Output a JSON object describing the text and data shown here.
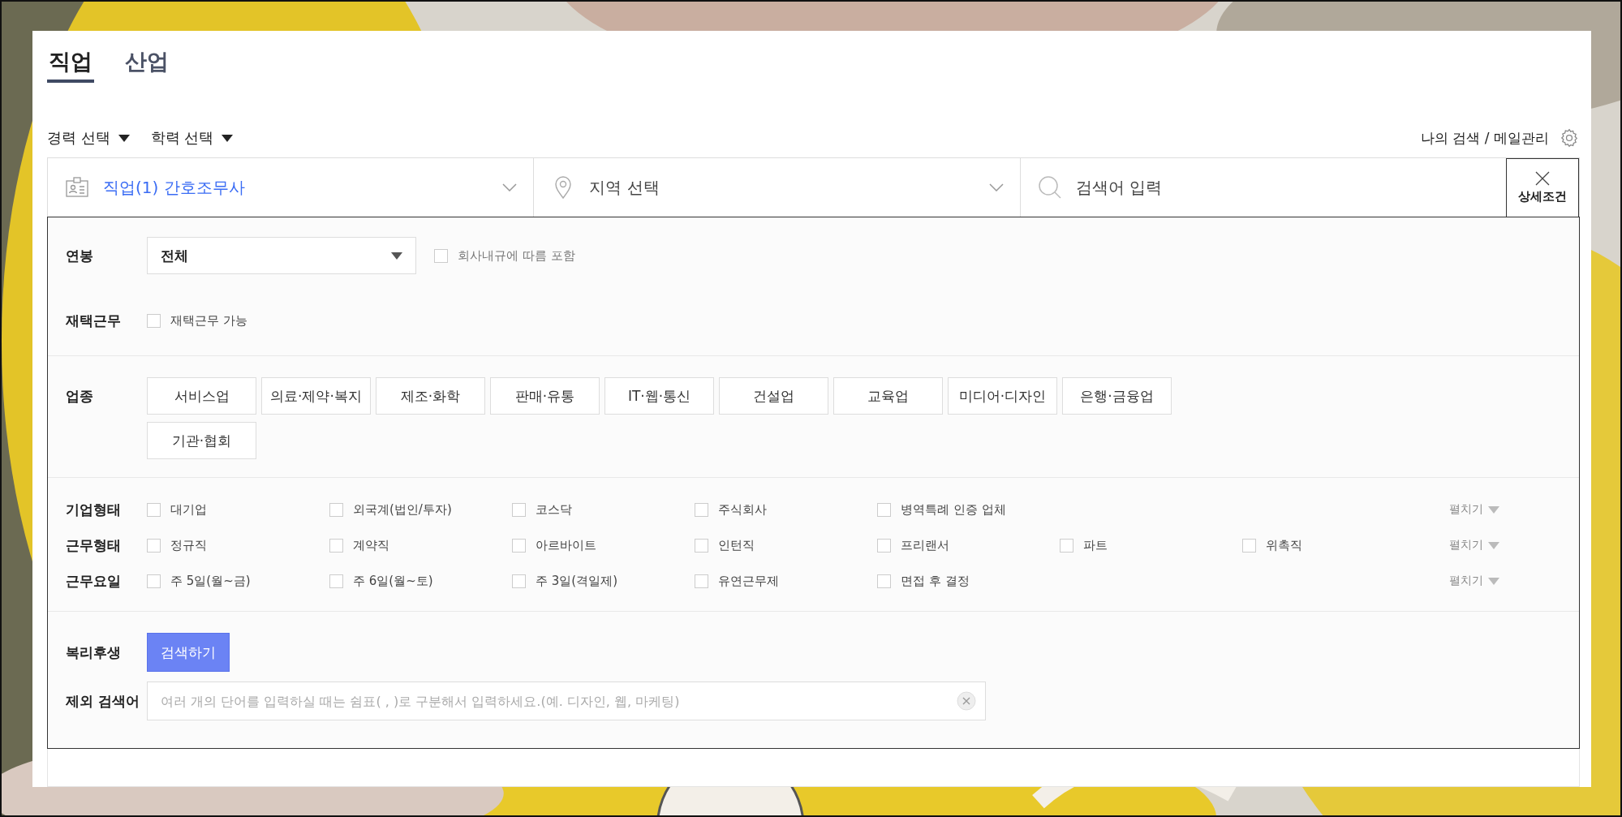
{
  "tabs": [
    {
      "label": "직업",
      "selected": true
    },
    {
      "label": "산업",
      "selected": false
    }
  ],
  "filters": [
    {
      "label": "경력 선택"
    },
    {
      "label": "학력 선택"
    }
  ],
  "my_search_link": "나의 검색 / 메일관리",
  "search_bar": {
    "job_value": "직업(1) 간호조무사",
    "region_placeholder": "지역 선택",
    "keyword_placeholder": "검색어 입력",
    "detail_button": "상세조건"
  },
  "salary": {
    "label": "연봉",
    "value": "전체",
    "include_checkbox": {
      "label": "회사내규에 따름 포함",
      "checked": false
    }
  },
  "remote": {
    "label": "재택근무",
    "checkbox": {
      "label": "재택근무 가능",
      "checked": false
    }
  },
  "industry": {
    "label": "업종",
    "options": [
      {
        "label": "서비스업",
        "selected": false
      },
      {
        "label": "의료·제약·복지",
        "selected": false
      },
      {
        "label": "제조·화학",
        "selected": false
      },
      {
        "label": "판매·유통",
        "selected": false
      },
      {
        "label": "IT·웹·통신",
        "selected": false
      },
      {
        "label": "건설업",
        "selected": false
      },
      {
        "label": "교육업",
        "selected": false
      },
      {
        "label": "미디어·디자인",
        "selected": false
      },
      {
        "label": "은행·금융업",
        "selected": false
      },
      {
        "label": "기관·협회",
        "selected": false
      }
    ]
  },
  "checkbox_groups": [
    {
      "label": "기업형태",
      "expand": "펼치기",
      "options": [
        {
          "label": "대기업",
          "checked": false
        },
        {
          "label": "외국계(법인/투자)",
          "checked": false
        },
        {
          "label": "코스닥",
          "checked": false
        },
        {
          "label": "주식회사",
          "checked": false
        },
        {
          "label": "병역특례 인증 업체",
          "checked": false
        }
      ]
    },
    {
      "label": "근무형태",
      "expand": "펼치기",
      "options": [
        {
          "label": "정규직",
          "checked": false
        },
        {
          "label": "계약직",
          "checked": false
        },
        {
          "label": "아르바이트",
          "checked": false
        },
        {
          "label": "인턴직",
          "checked": false
        },
        {
          "label": "프리랜서",
          "checked": false
        },
        {
          "label": "파트",
          "checked": false
        },
        {
          "label": "위촉직",
          "checked": false
        }
      ]
    },
    {
      "label": "근무요일",
      "expand": "펼치기",
      "options": [
        {
          "label": "주 5일(월~금)",
          "checked": false
        },
        {
          "label": "주 6일(월~토)",
          "checked": false
        },
        {
          "label": "주 3일(격일제)",
          "checked": false
        },
        {
          "label": "유연근무제",
          "checked": false
        },
        {
          "label": "면접 후 결정",
          "checked": false
        }
      ]
    }
  ],
  "benefits": {
    "label": "복리후생",
    "button": "검색하기"
  },
  "exclude": {
    "label": "제외 검색어",
    "placeholder": "여러 개의 단어를 입력하실 때는 쉼표( , )로 구분해서 입력하세요.(예. 디자인, 웹, 마케팅)"
  }
}
